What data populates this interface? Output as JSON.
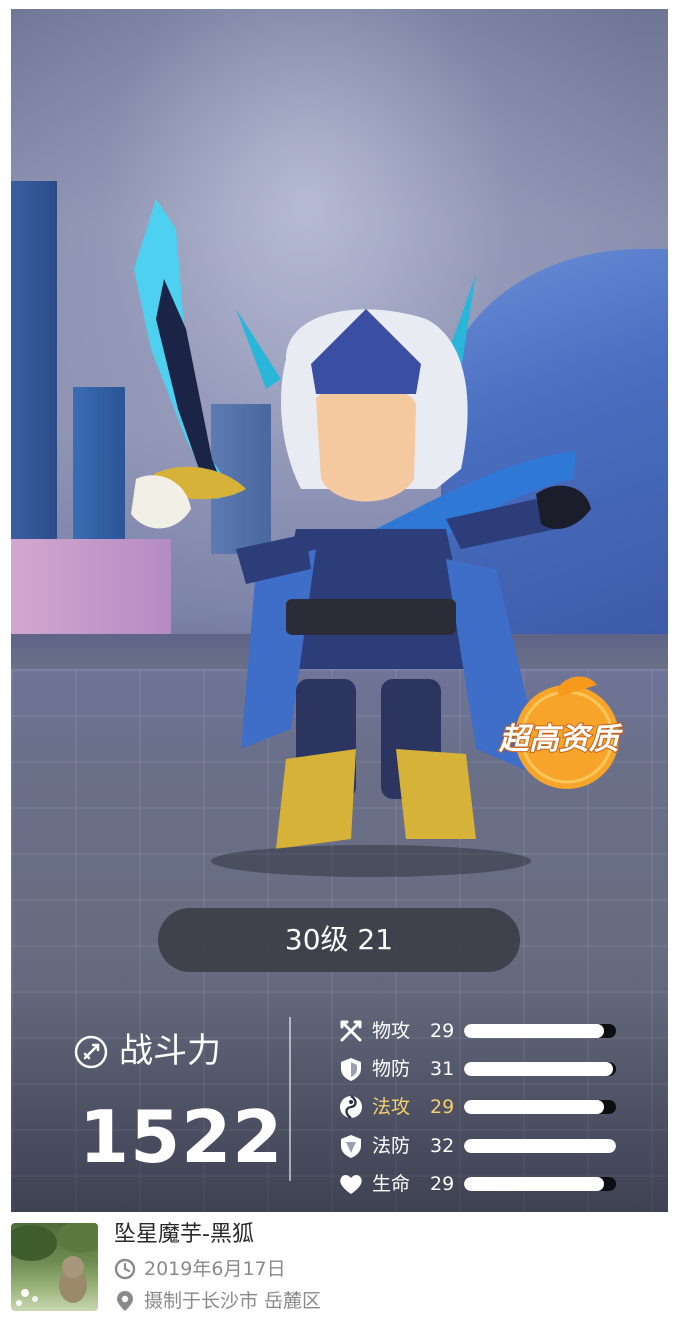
{
  "level": {
    "text": "30级 21"
  },
  "power": {
    "label": "战斗力",
    "value": "1522"
  },
  "stats": [
    {
      "name": "物攻",
      "value": "29",
      "fill": 0.92,
      "icon": "crossed-swords-icon",
      "highlight": false
    },
    {
      "name": "物防",
      "value": "31",
      "fill": 0.98,
      "icon": "shield-icon",
      "highlight": false
    },
    {
      "name": "法攻",
      "value": "29",
      "fill": 0.92,
      "icon": "magic-swirl-icon",
      "highlight": true
    },
    {
      "name": "法防",
      "value": "32",
      "fill": 1.0,
      "icon": "magic-shield-icon",
      "highlight": false
    },
    {
      "name": "生命",
      "value": "29",
      "fill": 0.92,
      "icon": "heart-icon",
      "highlight": false
    }
  ],
  "badge": {
    "text": "超高资质",
    "color": "#f6a52a"
  },
  "footer": {
    "title": "坠星魔芋-黑狐",
    "date": "2019年6月17日",
    "location": "摄制于长沙市 岳麓区"
  },
  "colors": {
    "highlight": "#f3cf6e",
    "pill": "#37384080",
    "text_muted": "#8a8a8a"
  }
}
